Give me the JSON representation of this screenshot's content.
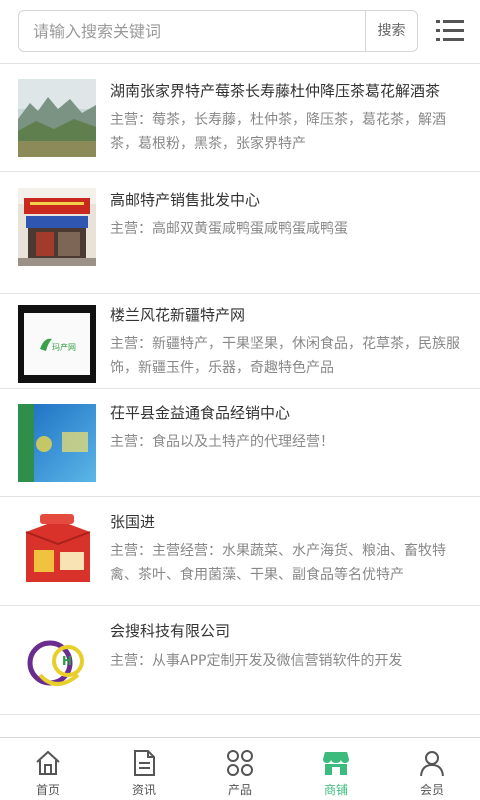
{
  "search": {
    "placeholder": "请输入搜索关键词",
    "button_label": "搜索"
  },
  "list": [
    {
      "title": "湖南张家界特产莓茶长寿藤杜仲降压茶葛花解酒茶",
      "prefix": "主营：",
      "desc": "莓茶，长寿藤，杜仲茶，降压茶，葛花茶，解酒茶，葛根粉，黑茶，张家界特产"
    },
    {
      "title": "高邮特产销售批发中心",
      "prefix": "主营：",
      "desc": "高邮双黄蛋咸鸭蛋咸鸭蛋咸鸭蛋"
    },
    {
      "title": "楼兰风花新疆特产网",
      "prefix": "主营：",
      "desc": "新疆特产，干果坚果，休闲食品，花草茶，民族服饰，新疆玉件，乐器，奇趣特色产品"
    },
    {
      "title": "茌平县金益通食品经销中心",
      "prefix": "主营：",
      "desc": "食品以及土特产的代理经营！"
    },
    {
      "title": "张国进",
      "prefix": "主营：",
      "desc": "主营经营：水果蔬菜、水产海货、粮油、畜牧特禽、茶叶、食用菌藻、干果、副食品等名优特产"
    },
    {
      "title": "会搜科技有限公司",
      "prefix": "主营：",
      "desc": "从事APP定制开发及微信营销软件的开发"
    }
  ],
  "tabs": [
    {
      "label": "首页",
      "icon": "home-icon"
    },
    {
      "label": "资讯",
      "icon": "news-icon"
    },
    {
      "label": "产品",
      "icon": "grid-icon"
    },
    {
      "label": "商铺",
      "icon": "shop-icon"
    },
    {
      "label": "会员",
      "icon": "user-icon"
    }
  ],
  "colors": {
    "accent": "#3dbb7d",
    "text": "#333333",
    "muted": "#888888",
    "divider": "#e3e3e3"
  }
}
